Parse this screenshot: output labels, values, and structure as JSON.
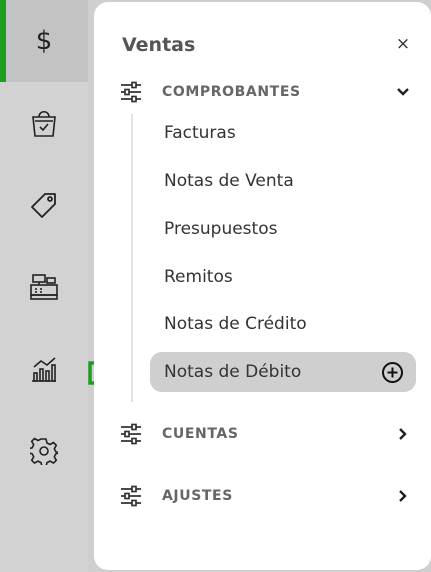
{
  "rail": {
    "items": [
      {
        "name": "ventas",
        "icon": "dollar-icon",
        "glyph": "$",
        "active": true
      },
      {
        "name": "compras",
        "icon": "shopping-bag-icon"
      },
      {
        "name": "productos",
        "icon": "tag-icon"
      },
      {
        "name": "caja",
        "icon": "cash-register-icon"
      },
      {
        "name": "reportes",
        "icon": "bar-chart-icon"
      },
      {
        "name": "configuracion",
        "icon": "gear-icon"
      }
    ]
  },
  "panel": {
    "title": "Ventas",
    "close_glyph": "×",
    "sections": {
      "comprobantes": {
        "label": "COMPROBANTES",
        "expanded": true,
        "items": [
          "Facturas",
          "Notas de Venta",
          "Presupuestos",
          "Remitos",
          "Notas de Crédito",
          "Notas de Débito"
        ],
        "selected": "Notas de Débito"
      },
      "cuentas": {
        "label": "CUENTAS",
        "expanded": false
      },
      "ajustes": {
        "label": "AJUSTES",
        "expanded": false
      }
    }
  },
  "colors": {
    "accent": "#1e9e1e",
    "selected_bg": "#cfcfcf",
    "rail_bg": "#d2d2d2",
    "arrow": "#1e9e1e"
  }
}
